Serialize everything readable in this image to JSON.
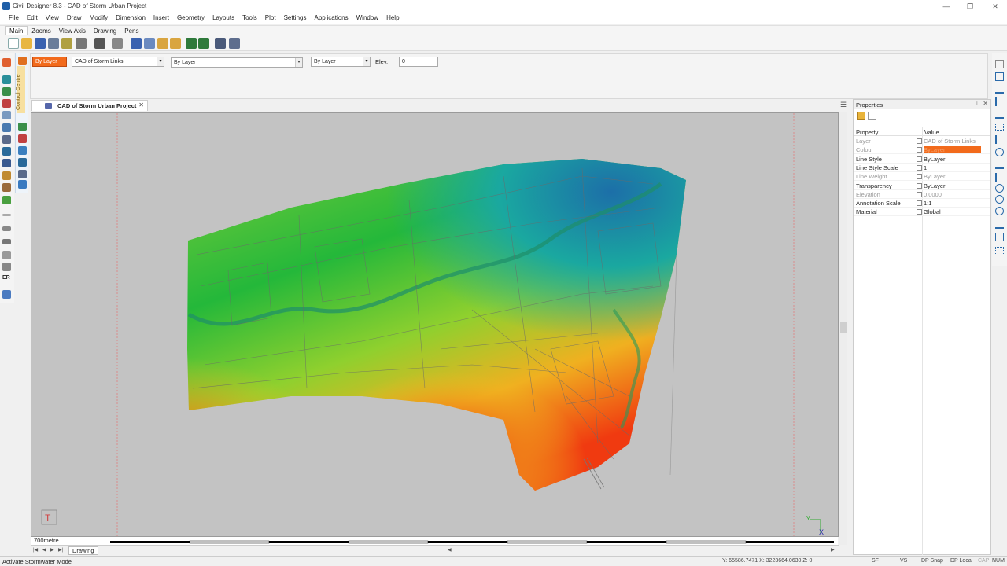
{
  "window": {
    "title": "Civil Designer 8.3 - CAD of Storm Urban Project",
    "minimize": "—",
    "restore": "❐",
    "close": "✕"
  },
  "menu": [
    "File",
    "Edit",
    "View",
    "Draw",
    "Modify",
    "Dimension",
    "Insert",
    "Geometry",
    "Layouts",
    "Tools",
    "Plot",
    "Settings",
    "Applications",
    "Window",
    "Help"
  ],
  "toolbar_tabs": [
    "Main",
    "Zooms",
    "View Axis",
    "Drawing",
    "Pens"
  ],
  "toolbar_active_tab": "Main",
  "propbar": {
    "layer_button": "By Layer",
    "layer_select": "CAD of Storm Links",
    "linestyle_select": "By Layer",
    "lineweight_select": "By Layer",
    "elev_label": "Elev.",
    "elev_value": "0"
  },
  "control_centre": "Control Centre",
  "document_tab": "CAD of Storm Urban Project",
  "scale_label": "700metre",
  "drawing_tab": "Drawing",
  "properties": {
    "title": "Properties",
    "col_property": "Property",
    "col_value": "Value",
    "rows": [
      {
        "name": "Layer",
        "value": "CAD of Storm Links",
        "bold": false
      },
      {
        "name": "Colour",
        "value": "ByLayer",
        "bold": false,
        "swatch": "#f26a1b"
      },
      {
        "name": "Line Style",
        "value": "ByLayer",
        "bold": true
      },
      {
        "name": "Line Style Scale",
        "value": "1",
        "bold": true
      },
      {
        "name": "Line Weight",
        "value": "ByLayer",
        "bold": false
      },
      {
        "name": "Transparency",
        "value": "ByLayer",
        "bold": true
      },
      {
        "name": "Elevation",
        "value": "0.0000",
        "bold": false
      },
      {
        "name": "Annotation Scale",
        "value": "1:1",
        "bold": true
      },
      {
        "name": "Material",
        "value": "Global",
        "bold": true
      }
    ]
  },
  "status": {
    "message": "Activate Stormwater Mode",
    "coords": "Y: 65586.7471 X: 3223664.0630 Z: 0",
    "flags": [
      "SF",
      "VS",
      "DP Snap",
      "DP Local",
      "CAP",
      "NUM"
    ]
  },
  "colors": {
    "accent_orange": "#f26a1b",
    "canvas": "#c3c3c3"
  }
}
